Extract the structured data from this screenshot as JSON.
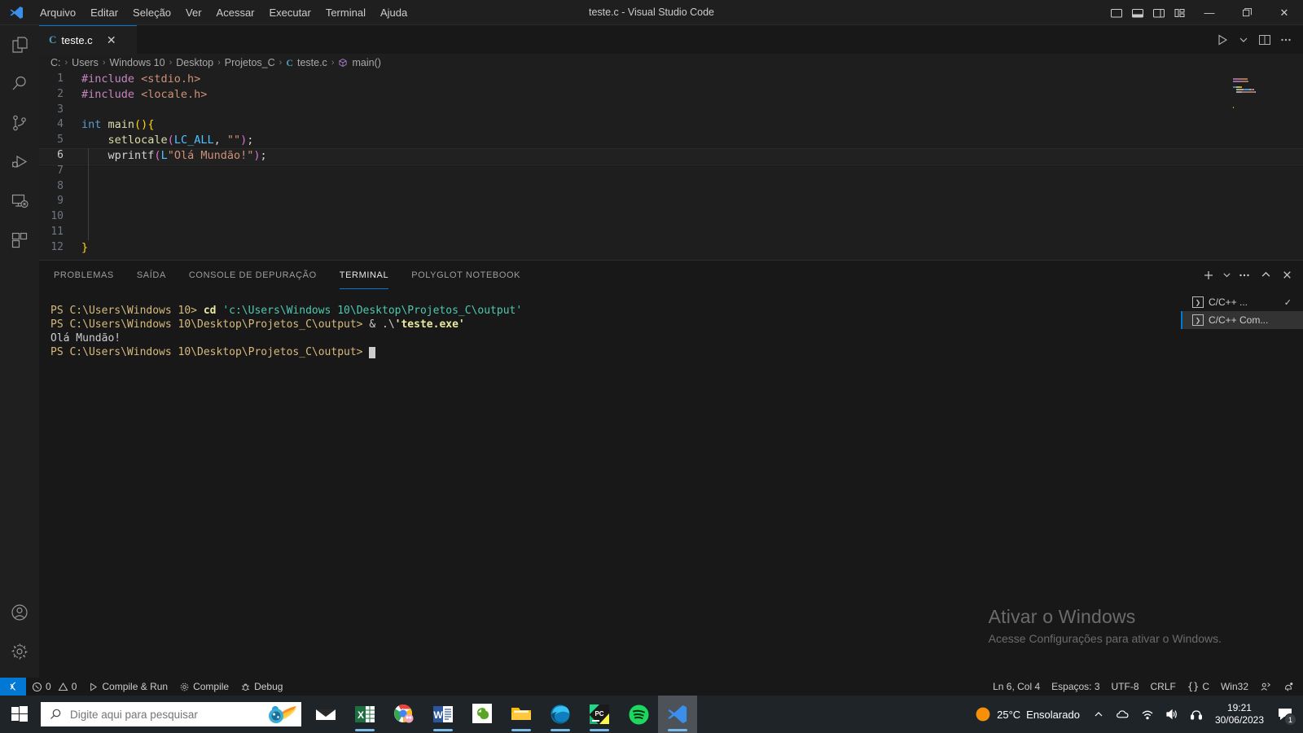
{
  "window": {
    "title": "teste.c - Visual Studio Code",
    "menu": [
      "Arquivo",
      "Editar",
      "Seleção",
      "Ver",
      "Acessar",
      "Executar",
      "Terminal",
      "Ajuda"
    ],
    "layout_buttons": [
      {
        "name": "toggle-primary-sidebar",
        "icon": "layout-sidebar-left-icon"
      },
      {
        "name": "toggle-panel",
        "icon": "layout-panel-icon"
      },
      {
        "name": "toggle-secondary-sidebar",
        "icon": "layout-sidebar-right-icon"
      },
      {
        "name": "customize-layout",
        "icon": "layout-customize-icon"
      }
    ],
    "controls": {
      "minimize": "—",
      "maximize": "❐",
      "close": "✕"
    }
  },
  "activitybar": {
    "items": [
      {
        "name": "explorer",
        "icon": "files-icon"
      },
      {
        "name": "search",
        "icon": "search-icon"
      },
      {
        "name": "source-control",
        "icon": "source-control-icon"
      },
      {
        "name": "run-and-debug",
        "icon": "run-debug-icon"
      },
      {
        "name": "remote-explorer",
        "icon": "remote-explorer-icon"
      },
      {
        "name": "extensions",
        "icon": "extensions-icon"
      }
    ],
    "bottom": [
      {
        "name": "accounts",
        "icon": "account-icon"
      },
      {
        "name": "manage",
        "icon": "gear-icon"
      }
    ]
  },
  "editor": {
    "tab": {
      "label": "teste.c",
      "file_icon": "C",
      "close": "✕"
    },
    "actions": [
      {
        "name": "run-code",
        "icon": "play-icon"
      },
      {
        "name": "run-options",
        "icon": "chevron-down-icon"
      },
      {
        "name": "split-editor",
        "icon": "split-editor-icon"
      },
      {
        "name": "more-actions",
        "icon": "ellipsis-icon"
      }
    ],
    "breadcrumb": [
      "C:",
      "Users",
      "Windows 10",
      "Desktop",
      "Projetos_C",
      "teste.c",
      "main()"
    ],
    "breadcrumb_separator": "›",
    "current_line": 6,
    "lines": [
      {
        "n": 1,
        "tokens": [
          {
            "t": "#include ",
            "c": "k-pre"
          },
          {
            "t": "<stdio.h>",
            "c": "k-str"
          }
        ]
      },
      {
        "n": 2,
        "tokens": [
          {
            "t": "#include ",
            "c": "k-pre"
          },
          {
            "t": "<locale.h>",
            "c": "k-str"
          }
        ]
      },
      {
        "n": 3,
        "tokens": []
      },
      {
        "n": 4,
        "tokens": [
          {
            "t": "int ",
            "c": "k-type"
          },
          {
            "t": "main",
            "c": "k-fn"
          },
          {
            "t": "(",
            "c": "k-paren1"
          },
          {
            "t": ")",
            "c": "k-paren1"
          },
          {
            "t": "{",
            "c": "k-paren1"
          }
        ]
      },
      {
        "n": 5,
        "tokens": [
          {
            "t": "    ",
            "c": "k-plain"
          },
          {
            "t": "setlocale",
            "c": "k-fn"
          },
          {
            "t": "(",
            "c": "k-paren2"
          },
          {
            "t": "LC_ALL",
            "c": "k-const"
          },
          {
            "t": ", ",
            "c": "k-plain"
          },
          {
            "t": "\"\"",
            "c": "k-str"
          },
          {
            "t": ")",
            "c": "k-paren2"
          },
          {
            "t": ";",
            "c": "k-plain"
          }
        ]
      },
      {
        "n": 6,
        "tokens": [
          {
            "t": "    ",
            "c": "k-plain"
          },
          {
            "t": "wprintf",
            "c": "k-plain"
          },
          {
            "t": "(",
            "c": "k-paren2"
          },
          {
            "t": "L",
            "c": "k-const"
          },
          {
            "t": "\"Olá Mundão!\"",
            "c": "k-str"
          },
          {
            "t": ")",
            "c": "k-paren2"
          },
          {
            "t": ";",
            "c": "k-plain"
          }
        ]
      },
      {
        "n": 7,
        "tokens": []
      },
      {
        "n": 8,
        "tokens": []
      },
      {
        "n": 9,
        "tokens": []
      },
      {
        "n": 10,
        "tokens": []
      },
      {
        "n": 11,
        "tokens": []
      },
      {
        "n": 12,
        "tokens": [
          {
            "t": "}",
            "c": "k-paren1"
          }
        ]
      }
    ]
  },
  "panel": {
    "tabs": [
      {
        "label": "PROBLEMAS",
        "active": false
      },
      {
        "label": "SAÍDA",
        "active": false
      },
      {
        "label": "CONSOLE DE DEPURAÇÃO",
        "active": false
      },
      {
        "label": "TERMINAL",
        "active": true
      },
      {
        "label": "POLYGLOT NOTEBOOK",
        "active": false
      }
    ],
    "actions": [
      {
        "name": "new-terminal",
        "icon": "plus-icon"
      },
      {
        "name": "terminal-profiles",
        "icon": "chevron-down-icon"
      },
      {
        "name": "views-and-more",
        "icon": "ellipsis-icon"
      },
      {
        "name": "maximize-panel",
        "icon": "chevron-up-icon"
      },
      {
        "name": "close-panel",
        "icon": "close-icon"
      }
    ],
    "terminal_lines": [
      [
        {
          "t": "PS C:\\Users\\Windows 10> ",
          "c": "t-prompt"
        },
        {
          "t": "cd ",
          "c": "t-cmd"
        },
        {
          "t": "'c:\\Users\\Windows 10\\Desktop\\Projetos_C\\output'",
          "c": "t-path"
        }
      ],
      [
        {
          "t": "PS C:\\Users\\Windows 10\\Desktop\\Projetos_C\\output> ",
          "c": "t-prompt"
        },
        {
          "t": "& ",
          "c": "t-white"
        },
        {
          "t": ".\\",
          "c": "t-white"
        },
        {
          "t": "'teste.exe'",
          "c": "t-exe"
        }
      ],
      [
        {
          "t": "Olá Mundão!",
          "c": "t-white"
        }
      ],
      [
        {
          "t": "PS C:\\Users\\Windows 10\\Desktop\\Projetos_C\\output> ",
          "c": "t-prompt"
        }
      ]
    ],
    "terminal_list": [
      {
        "label": "C/C++ ...",
        "active": false,
        "check": "✓"
      },
      {
        "label": "C/C++ Com...",
        "active": true,
        "check": ""
      }
    ]
  },
  "watermark": {
    "line1": "Ativar o Windows",
    "line2": "Acesse Configurações para ativar o Windows."
  },
  "statusbar": {
    "remote": {
      "name": "remote-window",
      "icon": "remote-icon"
    },
    "left": [
      {
        "name": "problems",
        "icon": "error-warning",
        "errors": "0",
        "warnings": "0"
      },
      {
        "name": "compile-and-run",
        "icon": "play-icon",
        "label": "Compile & Run"
      },
      {
        "name": "compile",
        "icon": "gear-icon",
        "label": "Compile"
      },
      {
        "name": "debug",
        "icon": "bug-icon",
        "label": "Debug"
      }
    ],
    "right": [
      {
        "name": "cursor-position",
        "label": "Ln 6, Col 4"
      },
      {
        "name": "indentation",
        "label": "Espaços: 3"
      },
      {
        "name": "encoding",
        "label": "UTF-8"
      },
      {
        "name": "eol",
        "label": "CRLF"
      },
      {
        "name": "language-mode",
        "label": "C",
        "icon": "braces-icon"
      },
      {
        "name": "platform",
        "label": "Win32"
      },
      {
        "name": "live-share",
        "icon": "live-share-icon"
      },
      {
        "name": "notifications",
        "icon": "bell-dot-icon"
      }
    ]
  },
  "taskbar": {
    "start": {
      "name": "start-button",
      "icon": "windows-logo-icon"
    },
    "search": {
      "placeholder": "Digite aqui para pesquisar",
      "value": "",
      "icon": "search-icon"
    },
    "cortana_icon": "cortana-orb-icon",
    "apps": [
      {
        "name": "mail",
        "icon": "mail-icon",
        "running": false
      },
      {
        "name": "excel",
        "icon": "excel-icon",
        "running": true
      },
      {
        "name": "chrome",
        "icon": "chrome-icon",
        "running": false
      },
      {
        "name": "word",
        "icon": "word-icon",
        "running": true
      },
      {
        "name": "evernote",
        "icon": "evernote-icon",
        "running": false
      },
      {
        "name": "file-explorer",
        "icon": "folder-icon",
        "running": true
      },
      {
        "name": "edge",
        "icon": "edge-icon",
        "running": true
      },
      {
        "name": "pycharm",
        "icon": "pycharm-icon",
        "running": true
      },
      {
        "name": "spotify",
        "icon": "spotify-icon",
        "running": false
      },
      {
        "name": "vscode",
        "icon": "vscode-icon",
        "running": true,
        "active": true
      }
    ],
    "weather": {
      "temp": "25°C",
      "condition": "Ensolarado",
      "icon": "sun-icon"
    },
    "tray": [
      {
        "name": "show-hidden-icons",
        "icon": "chevron-up-icon"
      },
      {
        "name": "onedrive",
        "icon": "cloud-icon"
      },
      {
        "name": "network",
        "icon": "wifi-icon"
      },
      {
        "name": "volume",
        "icon": "speaker-icon"
      },
      {
        "name": "bluetooth-audio",
        "icon": "headset-icon"
      }
    ],
    "clock": {
      "time": "19:21",
      "date": "30/06/2023"
    },
    "notifications": {
      "icon": "action-center-icon",
      "count": "1"
    }
  }
}
